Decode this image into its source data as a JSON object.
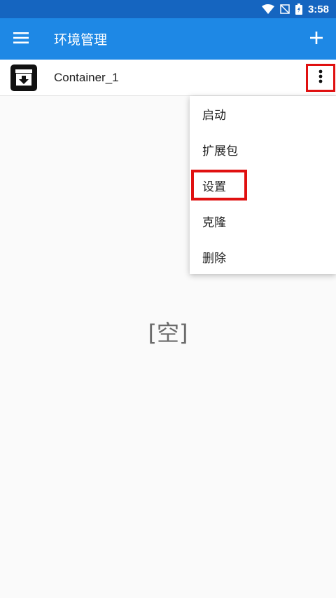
{
  "status_bar": {
    "time": "3:58",
    "icons": [
      "wifi-icon",
      "no-signal-icon",
      "battery-charging-icon"
    ]
  },
  "app_bar": {
    "title": "环境管理",
    "menu_icon": "hamburger-menu-icon",
    "add_icon": "plus-icon"
  },
  "list": {
    "items": [
      {
        "name": "Container_1",
        "icon": "archive-download-icon"
      }
    ]
  },
  "context_menu": {
    "items": [
      {
        "label": "启动"
      },
      {
        "label": "扩展包"
      },
      {
        "label": "设置"
      },
      {
        "label": "克隆"
      },
      {
        "label": "删除"
      }
    ],
    "highlighted_index": 2
  },
  "empty_state": {
    "text": "[空]"
  },
  "colors": {
    "status_bar": "#1565c0",
    "app_bar": "#1e88e5",
    "highlight": "#e01010",
    "background": "#fafafa"
  }
}
